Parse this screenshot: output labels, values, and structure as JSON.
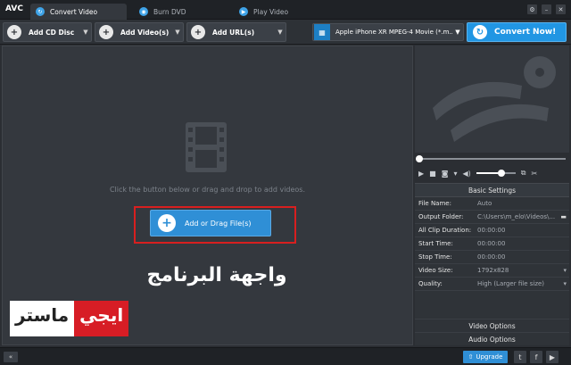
{
  "app": {
    "logo": "AVC"
  },
  "tabs": [
    {
      "label": "Convert Video",
      "icon": "convert-icon",
      "active": true
    },
    {
      "label": "Burn DVD",
      "icon": "disc-icon",
      "active": false
    },
    {
      "label": "Play Video",
      "icon": "play-icon",
      "active": false
    }
  ],
  "window_controls": {
    "settings": "⚙",
    "minimize": "–",
    "close": "✕"
  },
  "toolbar": {
    "add_cd": "Add CD Disc",
    "add_videos": "Add Video(s)",
    "add_url": "Add URL(s)",
    "profile": "Apple iPhone XR MPEG-4 Movie (*.m...",
    "convert": "Convert Now!"
  },
  "main": {
    "hint": "Click the button below or drag and drop to add videos.",
    "add_button": "Add or Drag File(s)",
    "overlay_title": "واجهة البرنامج",
    "brand_part1": "ايجي",
    "brand_part2": "ماستر"
  },
  "settings": {
    "header": "Basic Settings",
    "rows": [
      {
        "key": "File Name:",
        "value": "Auto"
      },
      {
        "key": "Output Folder:",
        "value": "C:\\Users\\m_elo\\Videos\\..."
      },
      {
        "key": "All Clip Duration:",
        "value": "00:00:00"
      },
      {
        "key": "Start Time:",
        "value": "00:00:00"
      },
      {
        "key": "Stop Time:",
        "value": "00:00:00"
      },
      {
        "key": "Video Size:",
        "value": "1792x828"
      },
      {
        "key": "Quality:",
        "value": "High (Larger file size)"
      }
    ],
    "video_options": "Video Options",
    "audio_options": "Audio Options"
  },
  "statusbar": {
    "collapse": "«",
    "upgrade": "Upgrade"
  },
  "colors": {
    "accent": "#2196e3",
    "highlight": "#d81f1f",
    "bg": "#2b2e33"
  }
}
